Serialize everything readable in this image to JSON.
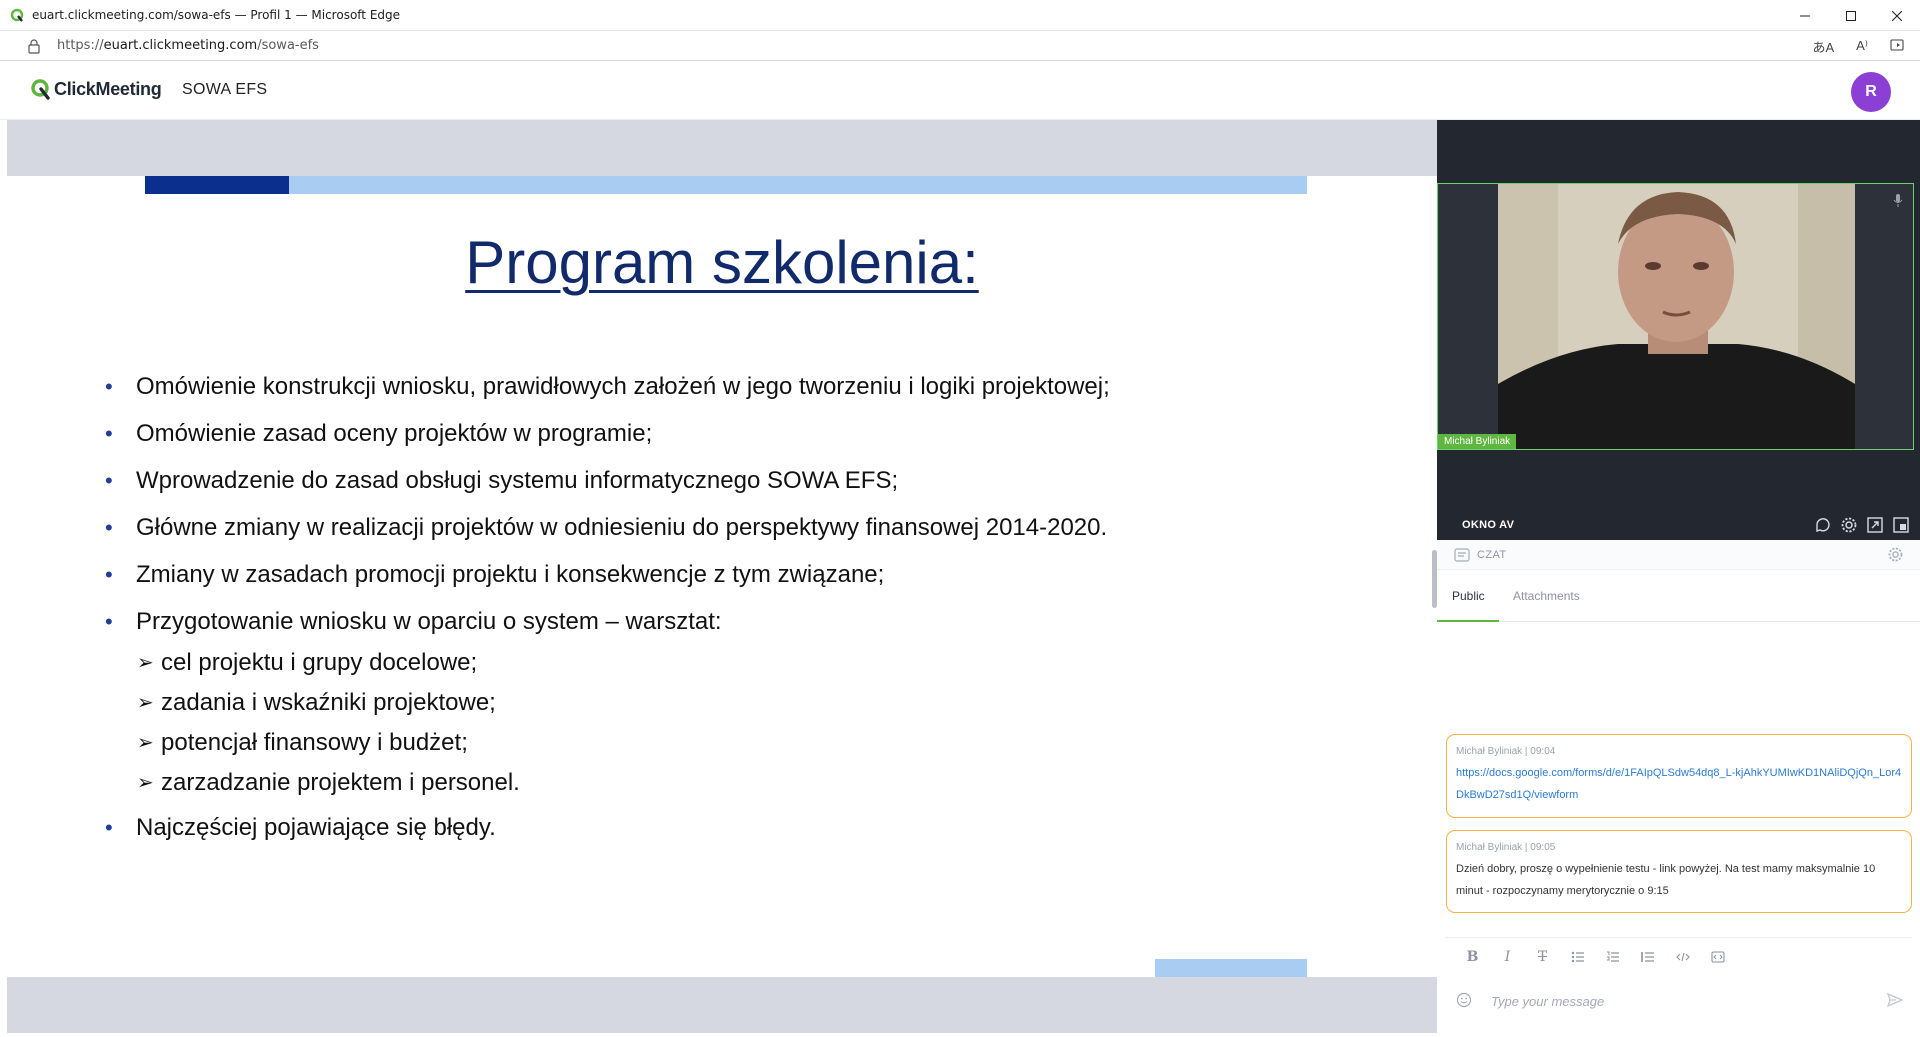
{
  "browser": {
    "window_title": "euart.clickmeeting.com/sowa-efs — Profil 1 — Microsoft Edge",
    "url_prefix": "https://",
    "url_host": "euart.clickmeeting.com",
    "url_path": "/sowa-efs"
  },
  "app": {
    "logo_text": "ClickMeeting",
    "event_name": "SOWA EFS",
    "avatar_initial": "R",
    "avatar_color": "#8b3fd4",
    "brand_green": "#5fb640"
  },
  "slide": {
    "title": "Program szkolenia:",
    "bullets": [
      "Omówienie konstrukcji wniosku, prawidłowych założeń w jego tworzeniu i logiki projektowej;",
      "Omówienie zasad oceny projektów w programie;",
      "Wprowadzenie do zasad obsługi systemu informatycznego SOWA EFS;",
      "Główne zmiany w realizacji projektów w odniesieniu do perspektywy finansowej 2014-2020.",
      "Zmiany w zasadach promocji projektu i konsekwencje z tym związane;",
      "Przygotowanie wniosku w oparciu o system – warsztat:"
    ],
    "sub_bullets": [
      "cel projektu i grupy docelowe;",
      "zadania i wskaźniki projektowe;",
      "potencjał finansowy i budżet;",
      "zarzadzanie projektem i personel."
    ],
    "last_bullet": "Najczęściej pojawiające się błędy."
  },
  "av": {
    "presenter_name": "Michał Byliniak",
    "label": "OKNO AV"
  },
  "chat": {
    "title": "CZAT",
    "tabs": [
      "Public",
      "Attachments"
    ],
    "messages": [
      {
        "author": "Michał Byliniak",
        "time": "09:04",
        "text": "https://docs.google.com/forms/d/e/1FAIpQLSdw54dq8_L-kjAhkYUMIwKD1NAliDQjQn_Lor4DkBwD27sd1Q/viewform"
      },
      {
        "author": "Michał Byliniak",
        "time": "09:05",
        "text": "Dzień dobry, proszę o wypełnienie testu - link powyżej. Na test mamy maksymalnie 10 minut - rozpoczynamy merytorycznie o 9:15"
      }
    ],
    "composer_placeholder": "Type your message"
  }
}
